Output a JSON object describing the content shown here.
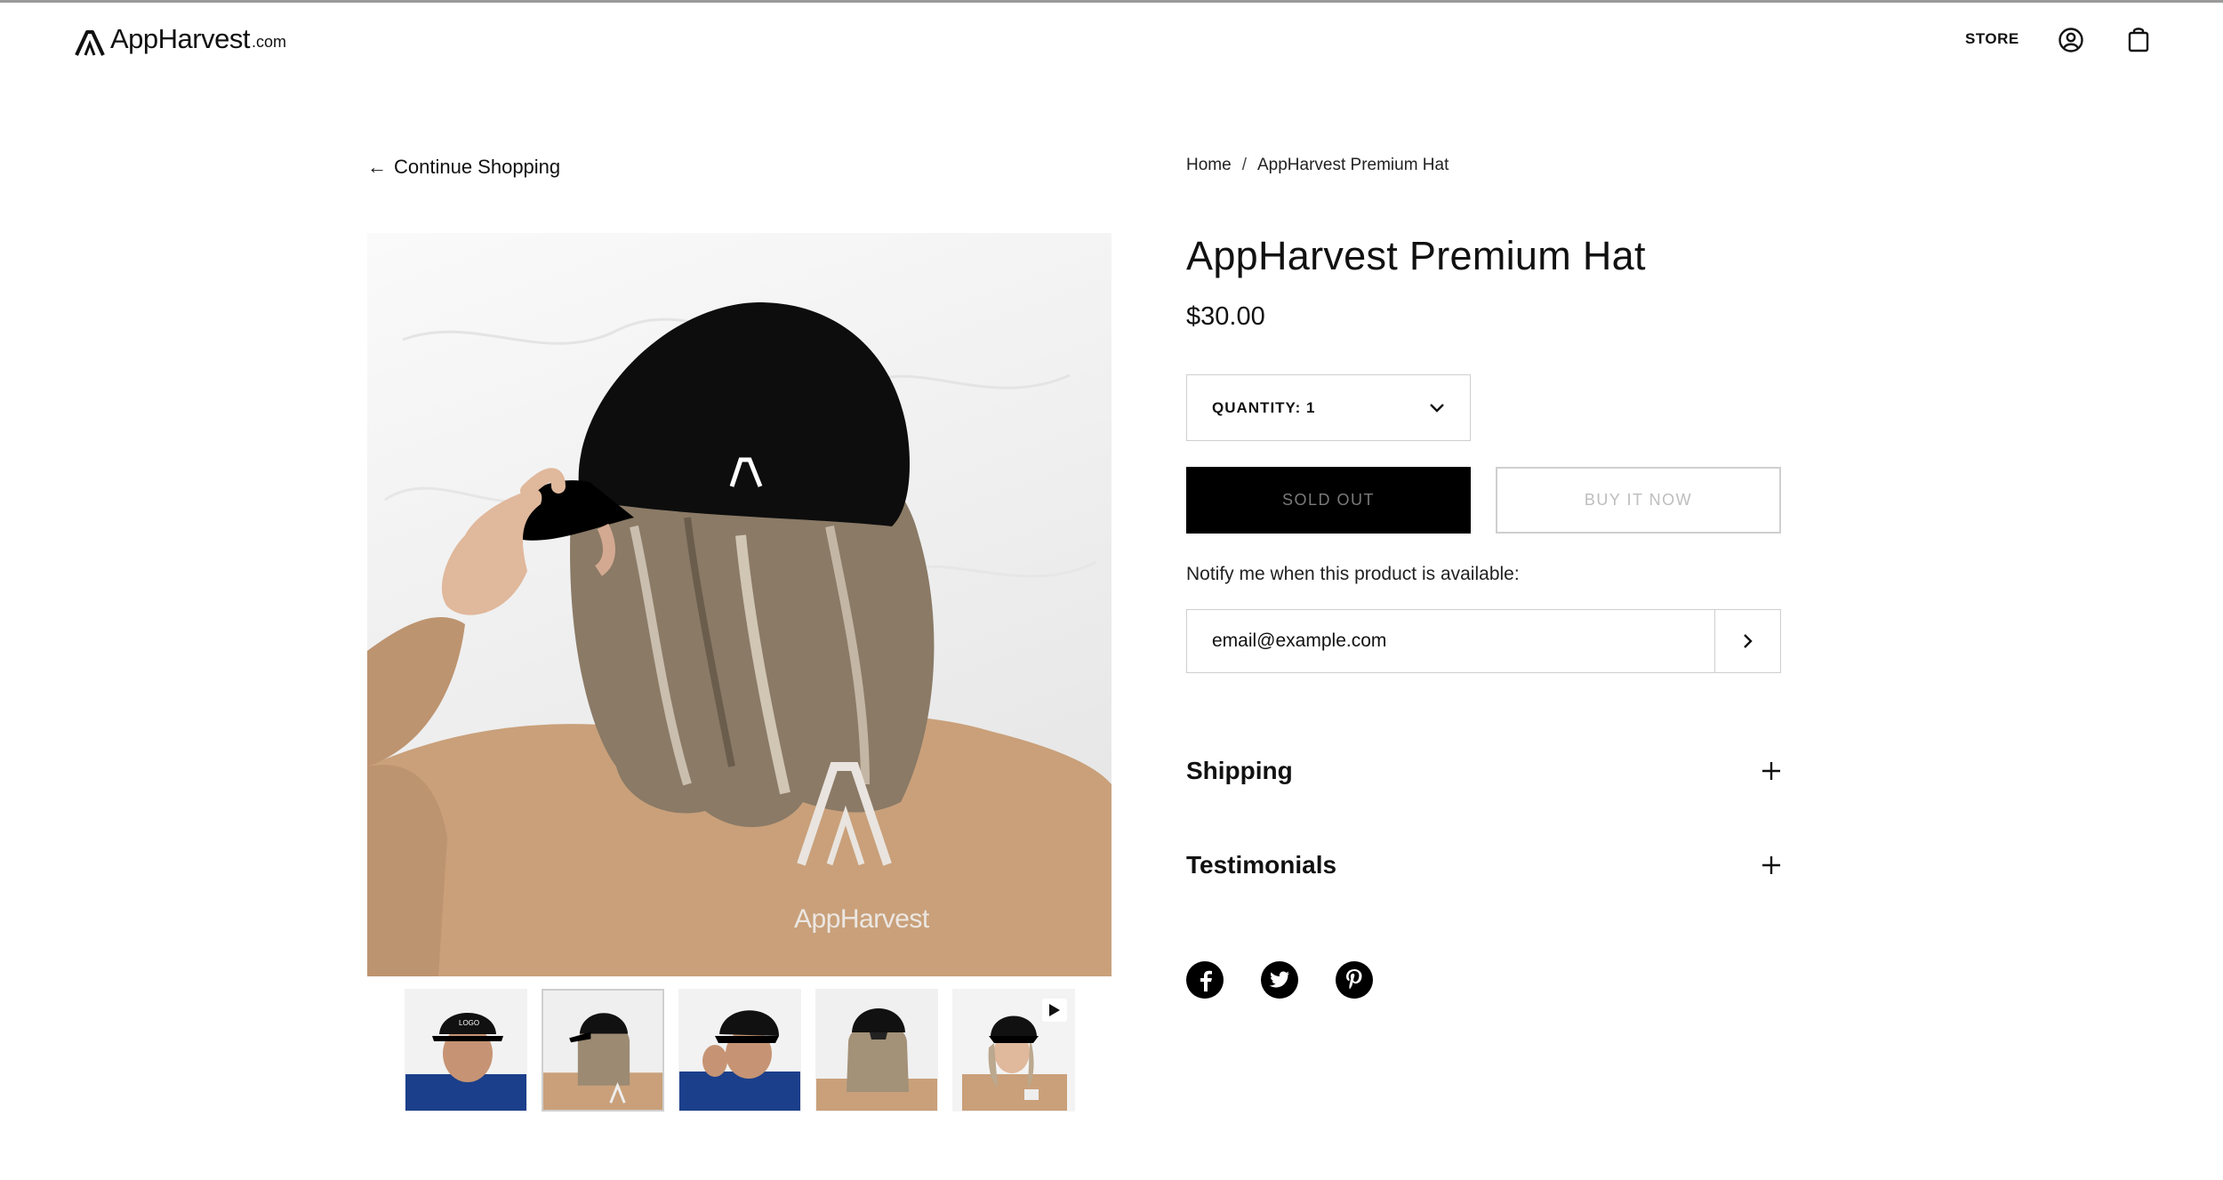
{
  "header": {
    "logo_main": "AppHarvest",
    "logo_suffix": ".com",
    "nav_store": "STORE",
    "account_icon": "user-circle-icon",
    "cart_icon": "shopping-bag-icon"
  },
  "nav": {
    "continue_shopping": "Continue Shopping"
  },
  "breadcrumb": {
    "home": "Home",
    "separator": "/",
    "current": "AppHarvest Premium Hat"
  },
  "product": {
    "title": "AppHarvest Premium Hat",
    "price": "$30.00",
    "quantity_label": "QUANTITY: 1",
    "sold_out_label": "SOLD OUT",
    "buy_now_label": "BUY IT NOW",
    "notify_label": "Notify me when this product is available:",
    "email_placeholder": "email@example.com",
    "main_image_brand": "AppHarvest"
  },
  "thumbnails": [
    {
      "subject": "man-blue-shirt",
      "selected": false,
      "video": false
    },
    {
      "subject": "woman-back-tan",
      "selected": true,
      "video": false
    },
    {
      "subject": "man-looking-down",
      "selected": false,
      "video": false
    },
    {
      "subject": "woman-back-cap",
      "selected": false,
      "video": false
    },
    {
      "subject": "woman-front-video",
      "selected": false,
      "video": true
    }
  ],
  "accordions": {
    "shipping": "Shipping",
    "testimonials": "Testimonials"
  },
  "social": [
    "facebook-icon",
    "twitter-icon",
    "pinterest-icon"
  ],
  "colors": {
    "primary": "#000000",
    "border": "#cfcfcf",
    "disabled_text": "#bdbdbd",
    "sweater": "#c9a07a",
    "shirt_blue": "#1b3f8a"
  }
}
